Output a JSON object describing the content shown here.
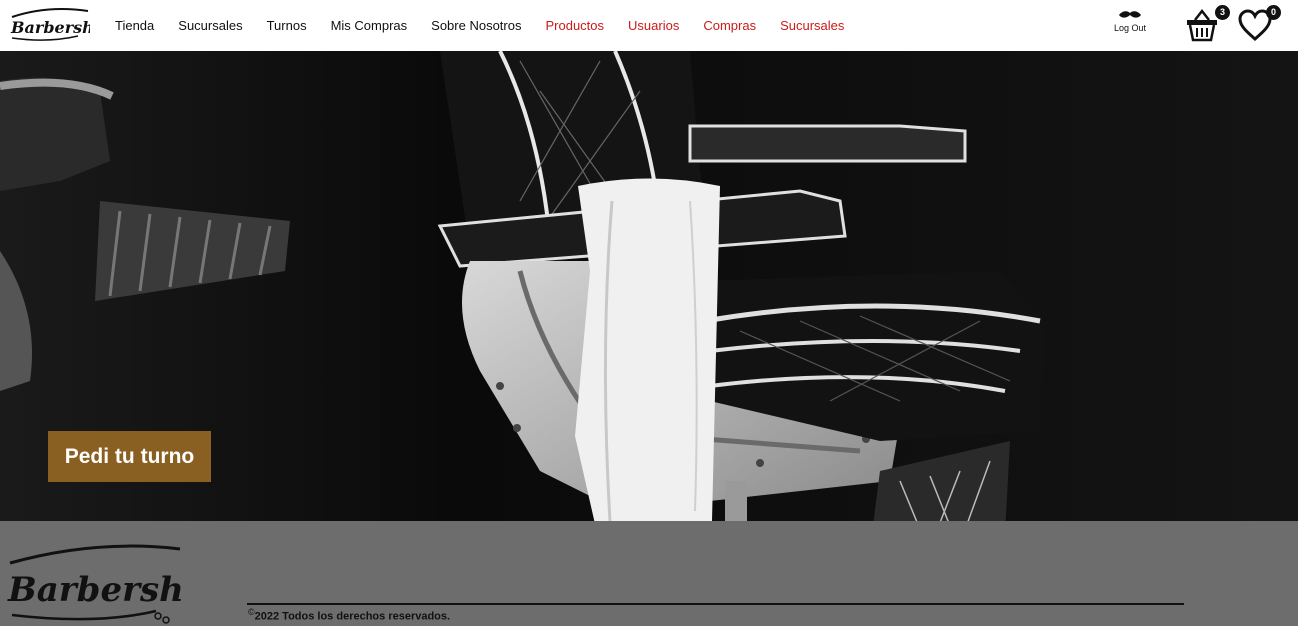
{
  "brand": {
    "name": "Barbershop"
  },
  "nav": {
    "links": [
      "Tienda",
      "Sucursales",
      "Turnos",
      "Mis Compras",
      "Sobre Nosotros"
    ],
    "admin_links": [
      "Productos",
      "Usuarios",
      "Compras",
      "Sucursales"
    ]
  },
  "user": {
    "logout_label": "Log Out",
    "icon": "mustache-icon"
  },
  "cart": {
    "count": "3",
    "icon": "basket-icon"
  },
  "favorites": {
    "count": "0",
    "icon": "heart-icon"
  },
  "hero": {
    "cta_label": "Pedi tu turno",
    "image": "barber-chair-photo"
  },
  "footer": {
    "copyright_symbol": "©",
    "copyright": "2022 Todos los derechos reservados."
  },
  "colors": {
    "accent": "#8a5f22",
    "admin_link": "#cc1a1a",
    "navbar_bg": "#ffffff"
  }
}
